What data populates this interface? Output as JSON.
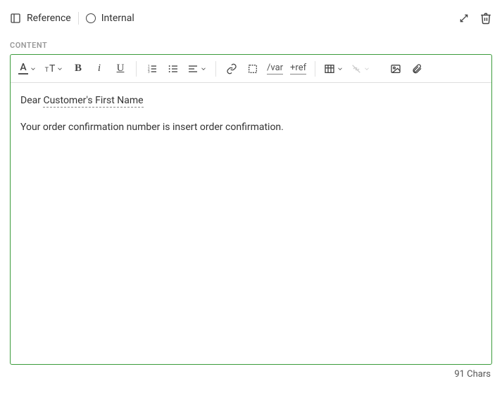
{
  "header": {
    "reference_label": "Reference",
    "internal_label": "Internal"
  },
  "section_label": "CONTENT",
  "toolbar": {
    "var_label": "/var",
    "ref_label": "+ref"
  },
  "editor": {
    "greeting_prefix": "Dear ",
    "greeting_token": "Customer's First Name",
    "body_line1": "Your order confirmation number is insert order confirmation."
  },
  "char_count": "91 Chars"
}
